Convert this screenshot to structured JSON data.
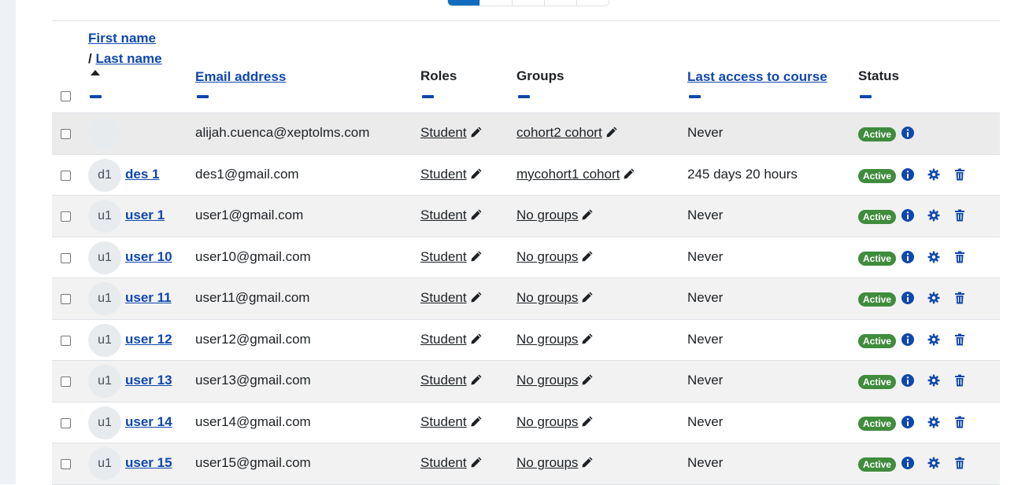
{
  "table": {
    "headers": {
      "first_name": "First name",
      "slash": " / ",
      "last_name": "Last name",
      "email": "Email address",
      "roles": "Roles",
      "groups": "Groups",
      "last_access": "Last access to course",
      "status": "Status"
    },
    "rows": [
      {
        "initials": "",
        "name": "",
        "email": "alijah.cuenca@xeptolms.com",
        "role": "Student",
        "groups": "cohort2 cohort",
        "access": "Never",
        "status": "Active",
        "actions": false
      },
      {
        "initials": "d1",
        "name": "des 1",
        "email": "des1@gmail.com",
        "role": "Student",
        "groups": "mycohort1 cohort",
        "access": "245 days 20 hours",
        "status": "Active",
        "actions": true
      },
      {
        "initials": "u1",
        "name": "user 1",
        "email": "user1@gmail.com",
        "role": "Student",
        "groups": "No groups",
        "access": "Never",
        "status": "Active",
        "actions": true
      },
      {
        "initials": "u1",
        "name": "user 10",
        "email": "user10@gmail.com",
        "role": "Student",
        "groups": "No groups",
        "access": "Never",
        "status": "Active",
        "actions": true
      },
      {
        "initials": "u1",
        "name": "user 11",
        "email": "user11@gmail.com",
        "role": "Student",
        "groups": "No groups",
        "access": "Never",
        "status": "Active",
        "actions": true
      },
      {
        "initials": "u1",
        "name": "user 12",
        "email": "user12@gmail.com",
        "role": "Student",
        "groups": "No groups",
        "access": "Never",
        "status": "Active",
        "actions": true
      },
      {
        "initials": "u1",
        "name": "user 13",
        "email": "user13@gmail.com",
        "role": "Student",
        "groups": "No groups",
        "access": "Never",
        "status": "Active",
        "actions": true
      },
      {
        "initials": "u1",
        "name": "user 14",
        "email": "user14@gmail.com",
        "role": "Student",
        "groups": "No groups",
        "access": "Never",
        "status": "Active",
        "actions": true
      },
      {
        "initials": "u1",
        "name": "user 15",
        "email": "user15@gmail.com",
        "role": "Student",
        "groups": "No groups",
        "access": "Never",
        "status": "Active",
        "actions": true
      }
    ]
  },
  "icons": {
    "edit": "pencil-icon",
    "info": "info-circle-icon",
    "settings": "gear-icon",
    "delete": "trash-icon"
  },
  "colors": {
    "link": "#0f47ad",
    "badge_active": "#3f8c3d",
    "pager_active": "#0f6cbf"
  }
}
